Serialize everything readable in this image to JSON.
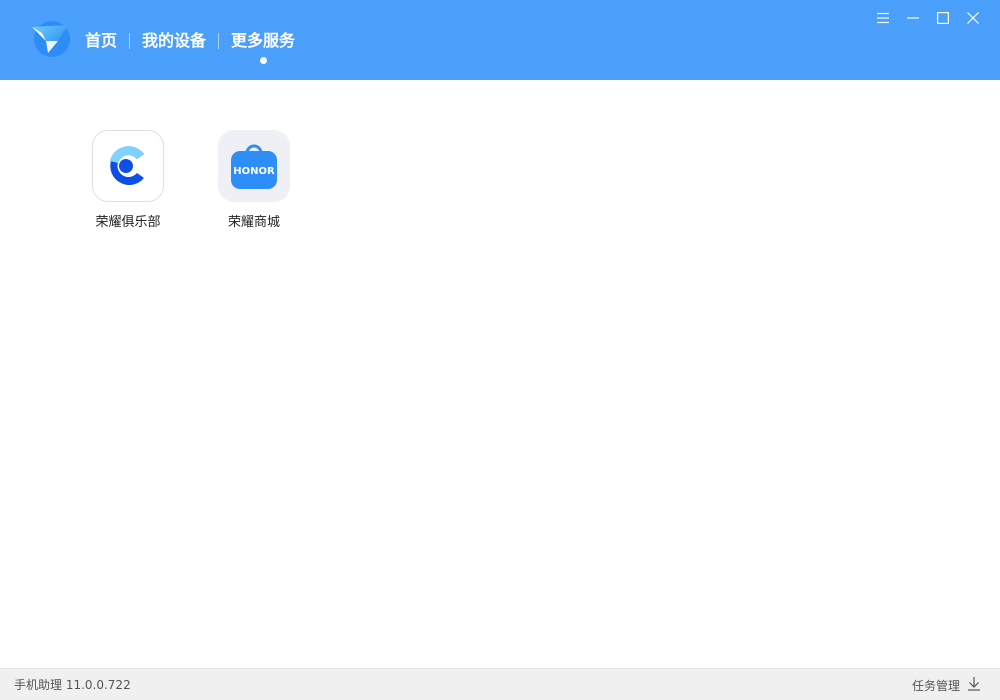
{
  "nav": {
    "items": [
      {
        "label": "首页"
      },
      {
        "label": "我的设备"
      },
      {
        "label": "更多服务"
      }
    ],
    "active_index": 2
  },
  "window_controls": {
    "icons": [
      "menu-icon",
      "minimize-icon",
      "maximize-icon",
      "close-icon"
    ]
  },
  "apps": [
    {
      "label": "荣耀俱乐部",
      "icon": "honor-club-icon"
    },
    {
      "label": "荣耀商城",
      "icon": "honor-mall-icon",
      "badge_text": "HONOR"
    }
  ],
  "footer": {
    "version": "手机助理 11.0.0.722",
    "task_manager_label": "任务管理"
  },
  "colors": {
    "header_bg": "#4a9ffb",
    "footer_bg": "#f0f0f0",
    "club_blue": "#0d4fe6",
    "club_light": "#7fd1ff",
    "mall_blue": "#2e8ef7"
  }
}
